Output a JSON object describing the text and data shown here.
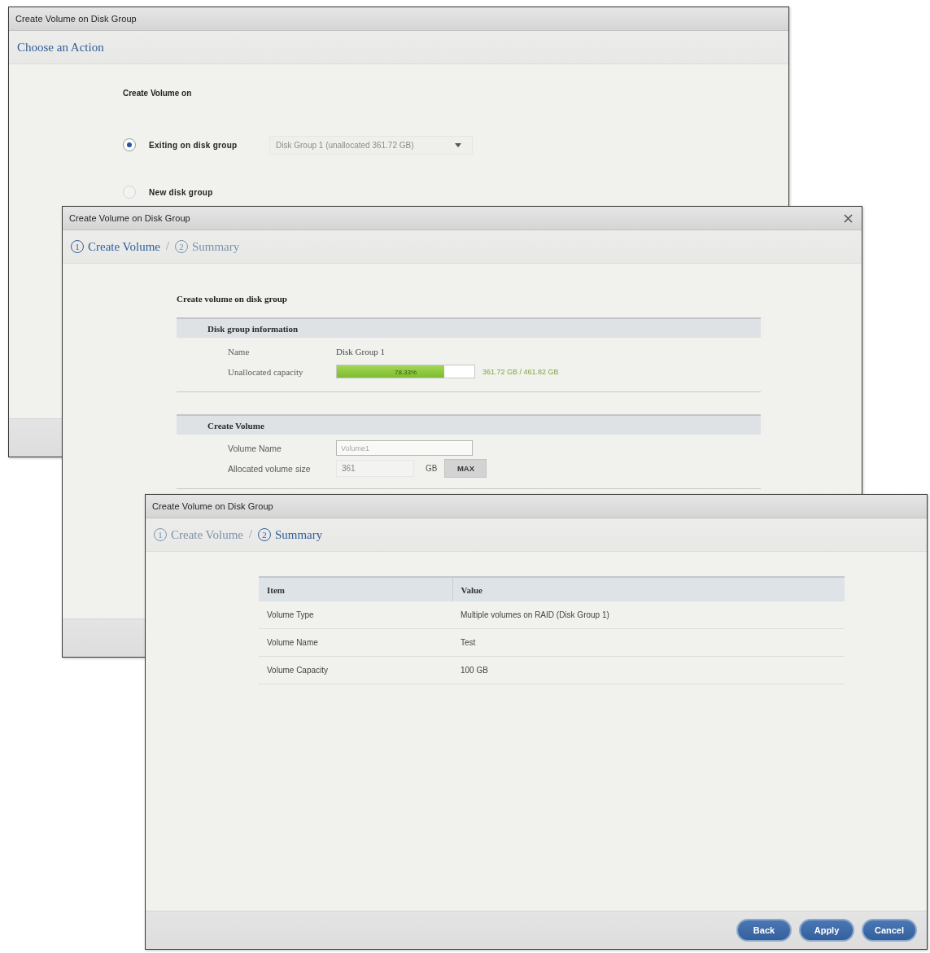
{
  "windows": [
    {
      "kind": "action",
      "title": "Create Volume on Disk Group",
      "closable": false,
      "steps": [
        {
          "label": "Choose an Action",
          "selected": true
        }
      ],
      "heading": "Create Volume on",
      "options": [
        {
          "label": "Exiting on disk group",
          "selected": true,
          "select": {
            "value": "Disk Group 1 (unallocated 361.72 GB)",
            "disabled": true
          }
        },
        {
          "label": "New disk group",
          "selected": false
        }
      ]
    },
    {
      "kind": "form",
      "title": "Create Volume on Disk Group",
      "closable": true,
      "steps": [
        {
          "number": "1",
          "label": "Create Volume",
          "selected": true
        },
        {
          "number": "2",
          "label": "Summary",
          "selected": false
        }
      ],
      "step_separator": "/",
      "heading": "Create volume on disk group",
      "sections": [
        {
          "title": "Disk group information",
          "rows": [
            {
              "kind": "text",
              "label": "Name",
              "value": "Disk Group 1"
            },
            {
              "kind": "meter",
              "label": "Unallocated capacity",
              "level": 0.78,
              "percent": "78.33%",
              "reading": "361.72 GB / 461.82 GB"
            }
          ]
        },
        {
          "title": "Create Volume",
          "rows": [
            {
              "kind": "input",
              "label": "Volume Name",
              "placeholder": "Volume1"
            },
            {
              "kind": "size",
              "label": "Allocated volume size",
              "value": "361",
              "disabled": true,
              "unit": "GB",
              "button": "MAX"
            }
          ]
        }
      ]
    },
    {
      "kind": "summary",
      "title": "Create Volume on Disk Group",
      "closable": false,
      "steps": [
        {
          "number": "1",
          "label": "Create Volume",
          "selected": false
        },
        {
          "number": "2",
          "label": "Summary",
          "selected": true
        }
      ],
      "step_separator": "/",
      "table": {
        "columns": [
          "Item",
          "Value"
        ],
        "rows": [
          [
            "Volume Type",
            "Multiple volumes on RAID (Disk Group 1)"
          ],
          [
            "Volume Name",
            "Test"
          ],
          [
            "Volume Capacity",
            "100 GB"
          ]
        ]
      },
      "buttons": [
        "Back",
        "Apply",
        "Cancel"
      ]
    }
  ]
}
